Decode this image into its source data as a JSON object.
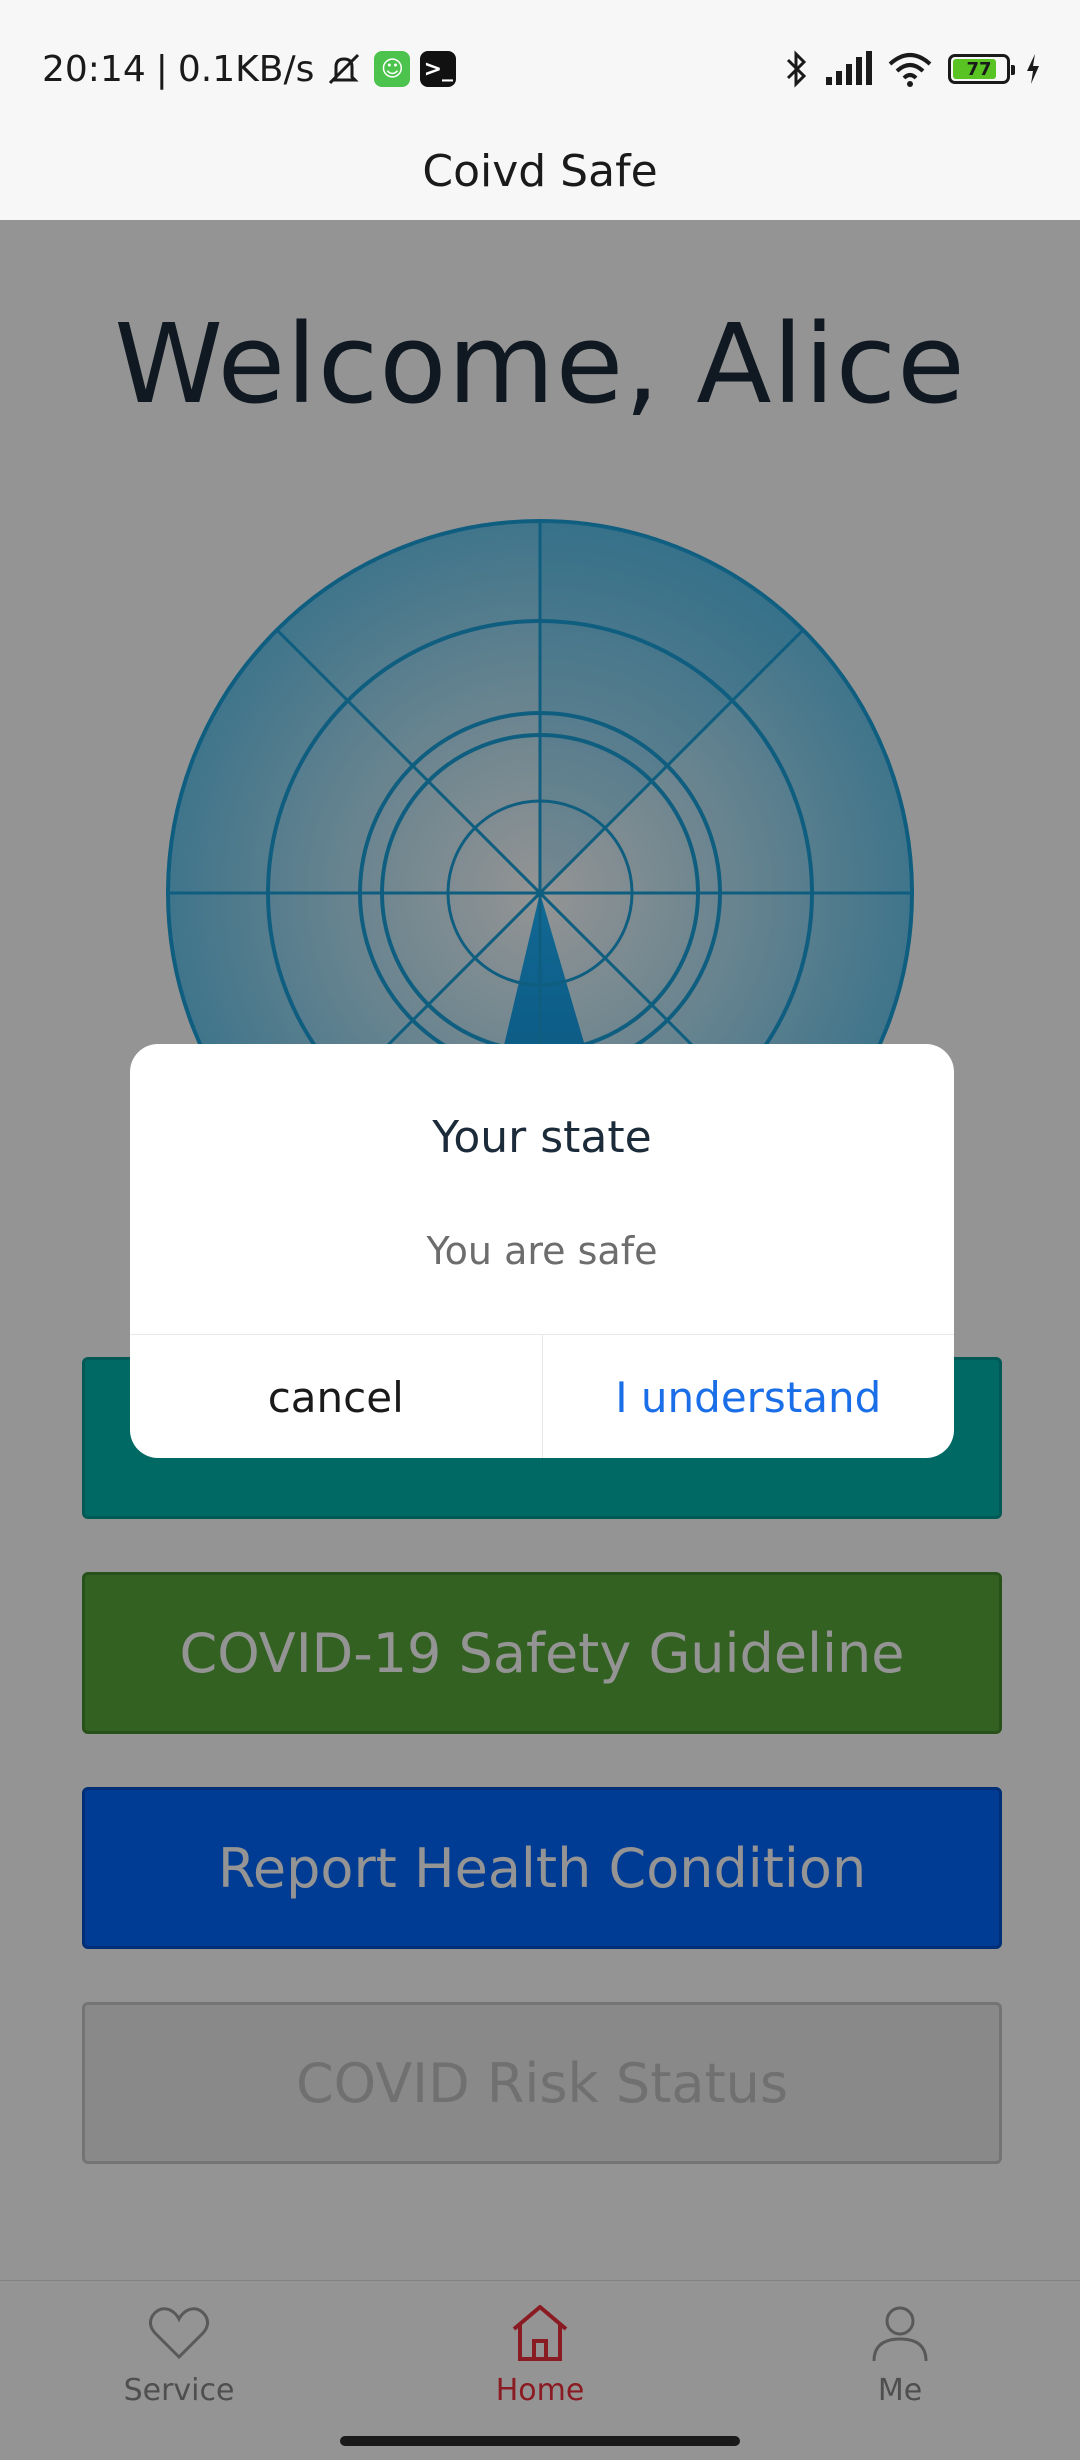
{
  "status_bar": {
    "time": "20:14",
    "separator": "|",
    "speed": "0.1KB/s",
    "battery": "77",
    "battery_level": 0.77,
    "icons": [
      "mute-icon",
      "app-chip-icon",
      "terminal-icon",
      "bluetooth-icon",
      "signal-icon",
      "wifi-icon",
      "battery-icon",
      "charging-icon"
    ]
  },
  "app_header": {
    "title": "Coivd Safe"
  },
  "main": {
    "welcome": "Welcome, Alice",
    "buttons": [
      {
        "label": "",
        "color": "#00b5ad"
      },
      {
        "label": "COVID-19 Safety Guideline",
        "color": "#56a83a"
      },
      {
        "label": "Report Health Condition",
        "color": "#0066ff"
      },
      {
        "label": "COVID Risk Status",
        "color": "#ececec"
      }
    ]
  },
  "dialog": {
    "title": "Your state",
    "message": "You are safe",
    "cancel_label": "cancel",
    "confirm_label": "I understand"
  },
  "tab_bar": {
    "active_color": "#f0303c",
    "items": [
      {
        "label": "Service",
        "icon": "heart-icon"
      },
      {
        "label": "Home",
        "icon": "home-icon"
      },
      {
        "label": "Me",
        "icon": "person-icon"
      }
    ]
  }
}
